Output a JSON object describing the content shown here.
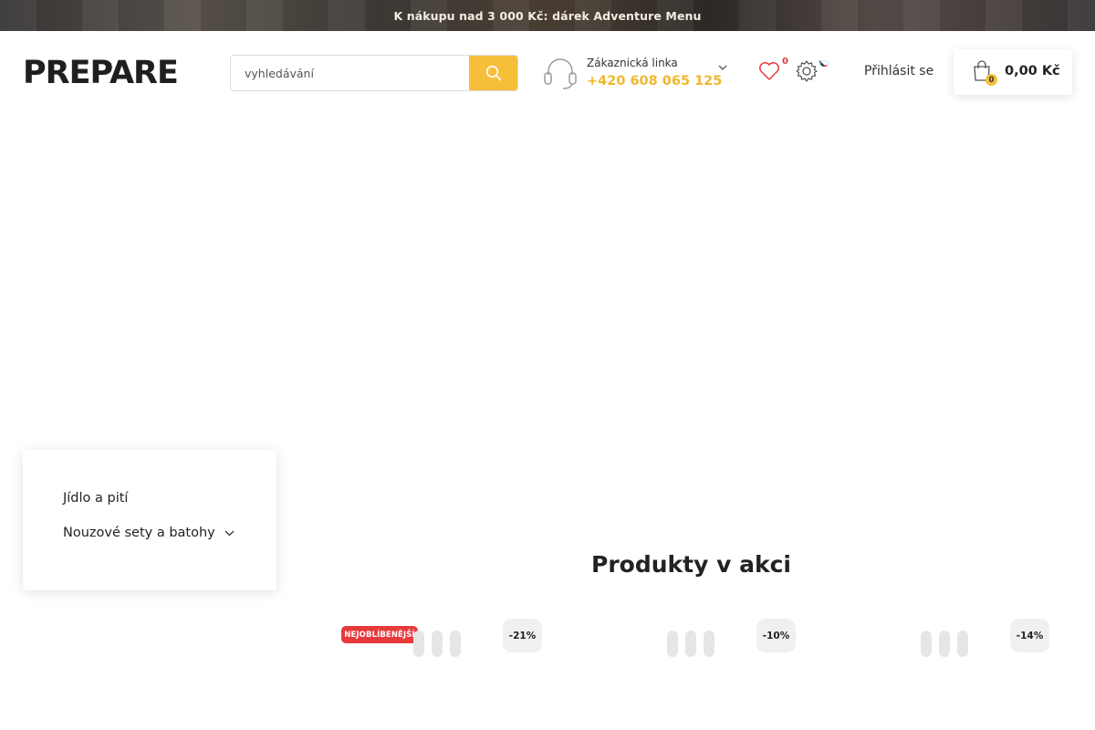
{
  "announcement": "K nákupu nad 3 000 Kč: dárek Adventure Menu",
  "logo": {
    "text": "PREPARE"
  },
  "search": {
    "placeholder": "vyhledávání"
  },
  "support": {
    "label": "Zákaznická linka",
    "phone": "+420 608 065 125"
  },
  "wishlist": {
    "count": "0"
  },
  "login": "Přihlásit se",
  "cart": {
    "count": "0",
    "total": "0,00 Kč"
  },
  "categories": [
    {
      "label": "Jídlo a pití"
    },
    {
      "label": "Nouzové sety a batohy"
    }
  ],
  "promo_section": {
    "title": "Produkty v akci",
    "products": [
      {
        "badge": "NEJOBLÍBENĚJŠÍ",
        "discount": "-21%"
      },
      {
        "discount": "-10%"
      },
      {
        "discount": "-14%"
      }
    ]
  },
  "colors": {
    "accent": "#f5bf3a",
    "phone": "#f0b72f",
    "badge": "#e8393c"
  }
}
